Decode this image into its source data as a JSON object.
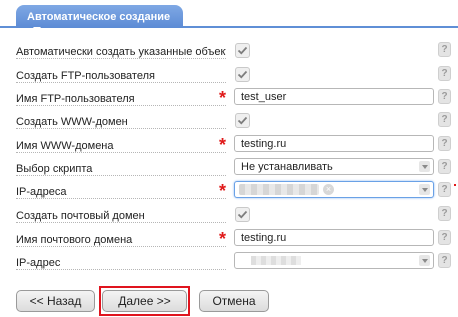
{
  "tab": {
    "label": "Автоматическое создание"
  },
  "rows": [
    {
      "label": "Автоматически создать указанные объекты",
      "type": "checkbox",
      "checked": true
    },
    {
      "label": "Создать FTP-пользователя",
      "type": "checkbox",
      "checked": true
    },
    {
      "label": "Имя FTP-пользователя",
      "type": "input",
      "required": true,
      "value": "test_user"
    },
    {
      "label": "Создать WWW-домен",
      "type": "checkbox",
      "checked": true
    },
    {
      "label": "Имя WWW-домена",
      "type": "input",
      "required": true,
      "value": "testing.ru"
    },
    {
      "label": "Выбор скрипта",
      "type": "select",
      "value": "Не устанавливать"
    },
    {
      "label": "IP-адреса",
      "type": "multiselect",
      "required": true
    },
    {
      "label": "Создать почтовый домен",
      "type": "checkbox",
      "checked": true
    },
    {
      "label": "Имя почтового домена",
      "type": "input",
      "required": true,
      "value": "testing.ru"
    },
    {
      "label": "IP-адрес",
      "type": "select-blurred"
    }
  ],
  "help_symbol": "?",
  "buttons": {
    "back": "<< Назад",
    "next": "Далее >>",
    "cancel": "Отмена"
  },
  "colors": {
    "tab": "#6a97dd",
    "required": "#e01a1a",
    "highlight": "#e0141e"
  }
}
